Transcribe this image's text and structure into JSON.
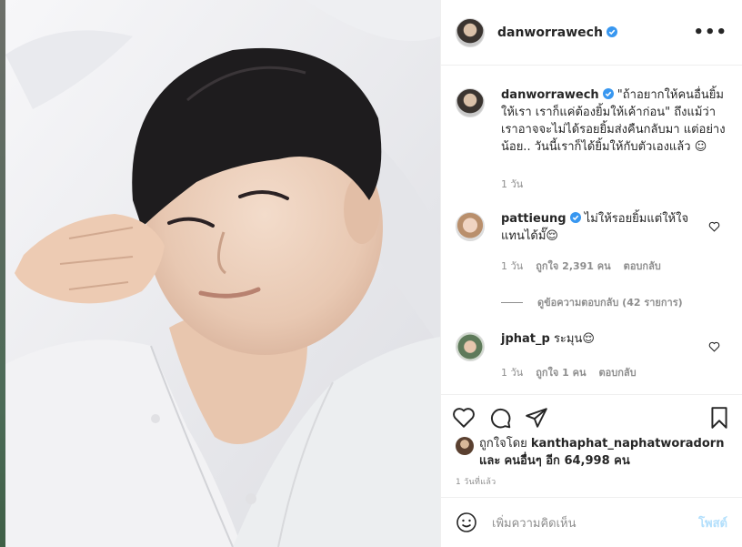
{
  "post": {
    "username": "danworrawech",
    "more_label": "•••"
  },
  "caption": {
    "username": "danworrawech",
    "text": "\"ถ้าอยากให้คนอื่นยิ้มให้เรา เราก็แค่ต้องยิ้มให้เค้าก่อน\" ถึงแม้ว่าเราอาจจะไม่ได้รอยยิ้มส่งคืนกลับมา แต่อย่างน้อย.. วันนี้เราก็ได้ยิ้มให้กับตัวเองแล้ว ☺",
    "time": "1 วัน"
  },
  "comments": [
    {
      "username": "pattieung",
      "text": "ไม่ให้รอยยิ้มแต่ให้ใจแทนได้มั๊😌",
      "time": "1 วัน",
      "likes": "ถูกใจ 2,391 คน",
      "reply": "ตอบกลับ",
      "view_replies": "ดูข้อความตอบกลับ (42 รายการ)"
    },
    {
      "username": "jphat_p",
      "text": "ระมุน😌",
      "time": "1 วัน",
      "likes": "ถูกใจ 1 คน",
      "reply": "ตอบกลับ"
    }
  ],
  "likes_line": {
    "prefix": "ถูกใจโดย",
    "user": "kanthaphat_naphatworadorn",
    "and": "และ",
    "others": "คนอื่นๆ อีก 64,998 คน"
  },
  "date": "1 วันที่แล้ว",
  "add_comment": {
    "placeholder": "เพิ่มความคิดเห็น",
    "post_label": "โพสต์"
  },
  "colors": {
    "verified": "#3897f0",
    "post_disabled": "#b2dffc",
    "meta": "#8e8e8e"
  }
}
